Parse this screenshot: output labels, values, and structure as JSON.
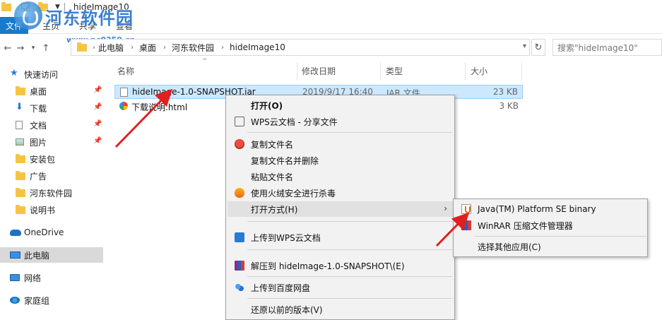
{
  "window": {
    "title": "hideImage10"
  },
  "watermark": {
    "brand": "河东软件园",
    "url": "www.pc0359.cn"
  },
  "ribbon": {
    "file_tab": "文件",
    "tabs": [
      "主页",
      "共享",
      "查看"
    ]
  },
  "address": {
    "crumbs": [
      "此电脑",
      "桌面",
      "河东软件园",
      "hideImage10"
    ],
    "search_placeholder": "搜索\"hideImage10\""
  },
  "nav": {
    "quick_access": "快速访问",
    "items": [
      {
        "label": "桌面",
        "pinned": true
      },
      {
        "label": "下载",
        "pinned": true
      },
      {
        "label": "文档",
        "pinned": true
      },
      {
        "label": "图片",
        "pinned": true
      },
      {
        "label": "安装包",
        "pinned": false
      },
      {
        "label": "广告",
        "pinned": false
      },
      {
        "label": "河东软件园",
        "pinned": false
      },
      {
        "label": "说明书",
        "pinned": false
      }
    ],
    "onedrive": "OneDrive",
    "this_pc": "此电脑",
    "network": "网络",
    "homegroup": "家庭组"
  },
  "columns": {
    "name": "名称",
    "date": "修改日期",
    "type": "类型",
    "size": "大小"
  },
  "files": [
    {
      "name": "hideImage-1.0-SNAPSHOT.jar",
      "date": "2019/9/17 16:40",
      "type": "JAR 文件",
      "size": "23 KB"
    },
    {
      "name": "下载说明.html",
      "date": "",
      "type": "",
      "size": "3 KB"
    }
  ],
  "context_menu": {
    "open": "打开(O)",
    "wps_share": "WPS云文档 - 分享文件",
    "copy_name": "复制文件名",
    "copy_name_delete": "复制文件名并删除",
    "paste_name": "粘贴文件名",
    "scan": "使用火绒安全进行杀毒",
    "open_with": "打开方式(H)",
    "upload_wps": "上传到WPS云文档",
    "extract_to": "解压到 hideImage-1.0-SNAPSHOT\\(E)",
    "upload_baidu": "上传到百度网盘",
    "restore_versions": "还原以前的版本(V)"
  },
  "submenu": {
    "java": "Java(TM) Platform SE binary",
    "winrar": "WinRAR 压缩文件管理器",
    "choose_other": "选择其他应用(C)"
  },
  "colors": {
    "file_tab": "#1979ca",
    "selection": "#cce8ff",
    "menu_bg": "#f2f2f2",
    "arrow": "#e02020"
  }
}
